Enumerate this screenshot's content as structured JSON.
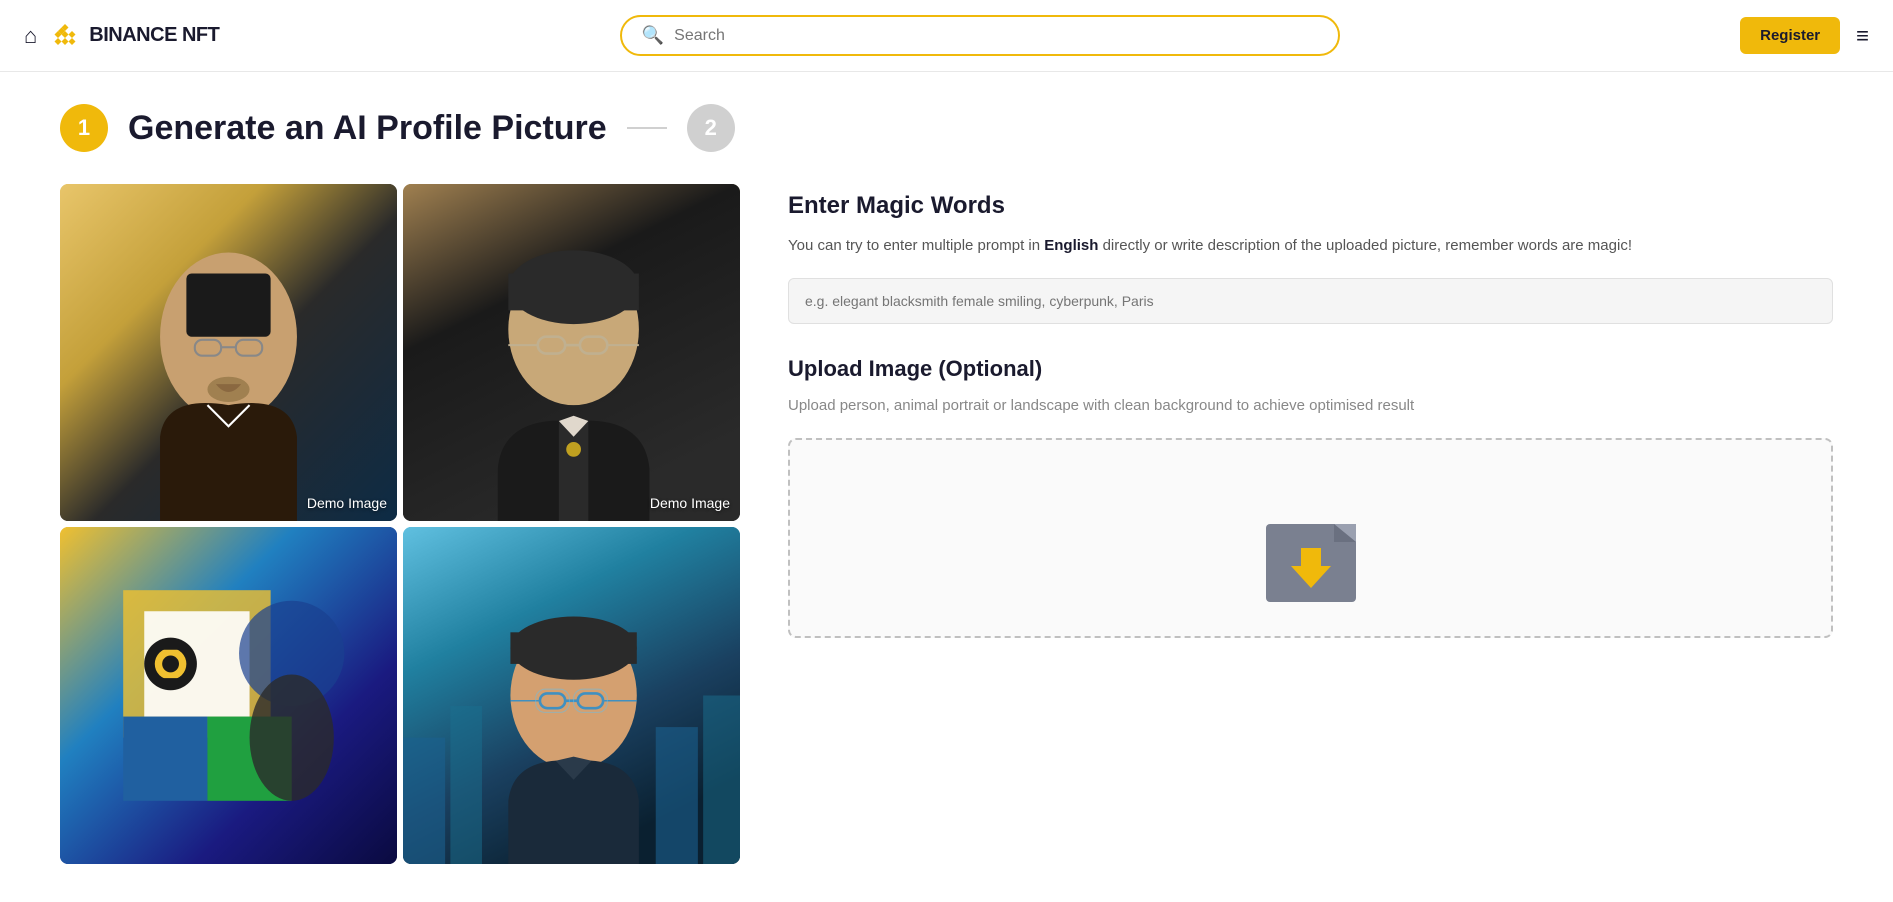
{
  "header": {
    "home_label": "🏠",
    "brand_name": "BINANCE",
    "brand_suffix": " NFT",
    "search_placeholder": "Search",
    "register_label": "Register",
    "menu_icon": "≡"
  },
  "page": {
    "step1_number": "1",
    "step1_title": "Generate an AI Profile Picture",
    "step2_number": "2"
  },
  "magic_words": {
    "title": "Enter Magic Words",
    "description_prefix": "You can try to enter multiple prompt in ",
    "description_bold": "English",
    "description_suffix": " directly or write description of the uploaded picture, remember words are magic!",
    "placeholder": "e.g. elegant blacksmith female smiling, cyberpunk, Paris"
  },
  "upload": {
    "title": "Upload Image (Optional)",
    "description": "Upload person, animal portrait or landscape with clean background to achieve optimised result"
  },
  "images": [
    {
      "label": "Demo Image",
      "variant": "portrait-1"
    },
    {
      "label": "Demo Image",
      "variant": "portrait-2"
    },
    {
      "label": "",
      "variant": "portrait-3"
    },
    {
      "label": "",
      "variant": "portrait-4"
    }
  ],
  "colors": {
    "accent": "#f0b90b",
    "primary_text": "#1a1a2e",
    "muted_text": "#888"
  }
}
